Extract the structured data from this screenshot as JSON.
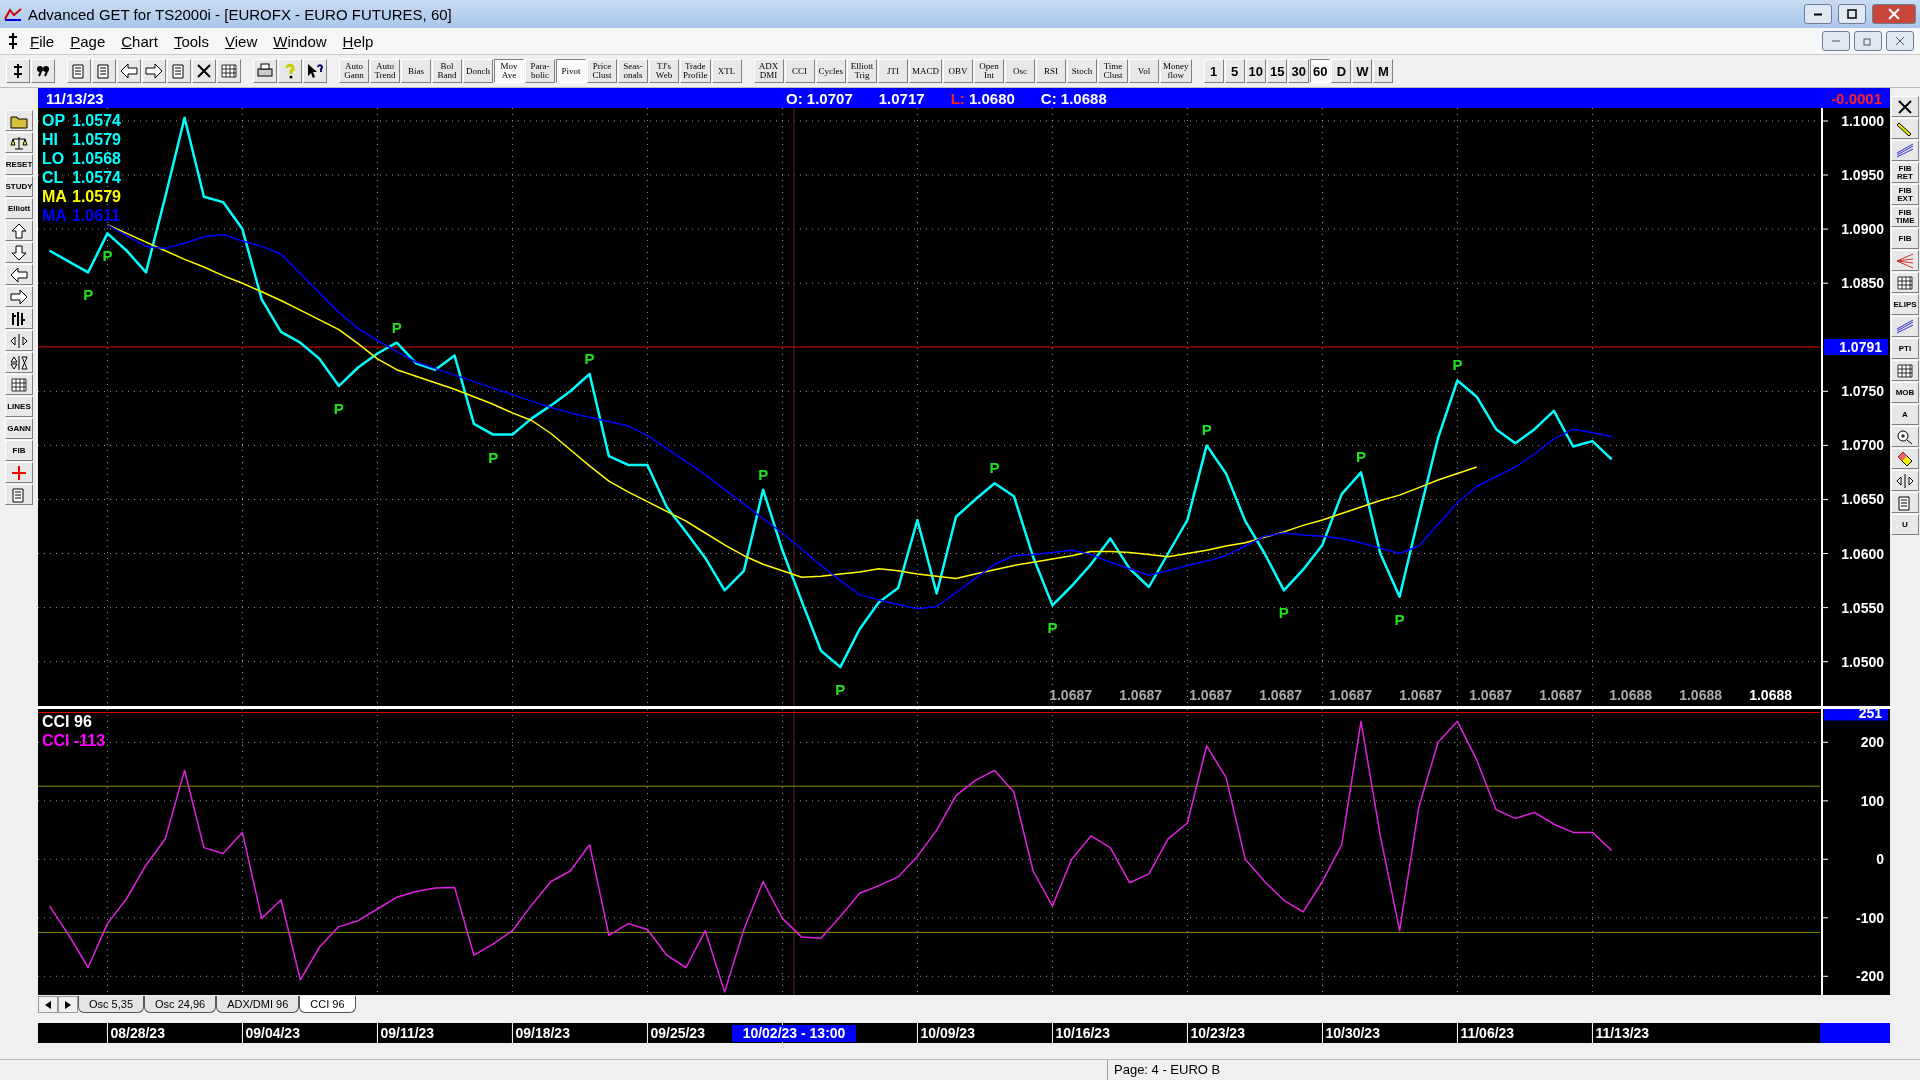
{
  "window": {
    "title": "Advanced GET for TS2000i - [EUROFX - EURO FUTURES, 60]"
  },
  "menu": [
    "File",
    "Page",
    "Chart",
    "Tools",
    "View",
    "Window",
    "Help"
  ],
  "study_buttons": [
    {
      "label": "Auto\nGann",
      "selected": false
    },
    {
      "label": "Auto\nTrend",
      "selected": false
    },
    {
      "label": "Bias",
      "selected": false
    },
    {
      "label": "Bol\nBand",
      "selected": false
    },
    {
      "label": "Donch",
      "selected": false
    },
    {
      "label": "Mov\nAve",
      "selected": true
    },
    {
      "label": "Para-\nbolic",
      "selected": false
    },
    {
      "label": "Pivot",
      "selected": true
    },
    {
      "label": "Price\nClust",
      "selected": false
    },
    {
      "label": "Seas-\nonals",
      "selected": false
    },
    {
      "label": "TJ's\nWeb",
      "selected": false
    },
    {
      "label": "Trade\nProfile",
      "selected": false
    },
    {
      "label": "XTL",
      "selected": false
    }
  ],
  "indicator_buttons": [
    {
      "label": "ADX\nDMI",
      "selected": false
    },
    {
      "label": "CCI",
      "selected": false
    },
    {
      "label": "Cycles",
      "selected": false
    },
    {
      "label": "Elliott\nTrig",
      "selected": false
    },
    {
      "label": "JTI",
      "selected": false
    },
    {
      "label": "MACD",
      "selected": false
    },
    {
      "label": "OBV",
      "selected": false
    },
    {
      "label": "Open\nInt",
      "selected": false
    },
    {
      "label": "Osc",
      "selected": false
    },
    {
      "label": "RSI",
      "selected": false
    },
    {
      "label": "Stoch",
      "selected": false
    },
    {
      "label": "Time\nClust",
      "selected": false
    },
    {
      "label": "Vol",
      "selected": false
    },
    {
      "label": "Money\nflow",
      "selected": false
    }
  ],
  "interval_buttons": [
    {
      "label": "1",
      "selected": false
    },
    {
      "label": "5",
      "selected": false
    },
    {
      "label": "10",
      "selected": false
    },
    {
      "label": "15",
      "selected": false
    },
    {
      "label": "30",
      "selected": false
    },
    {
      "label": "60",
      "selected": true
    },
    {
      "label": "D",
      "selected": false
    },
    {
      "label": "W",
      "selected": false
    },
    {
      "label": "M",
      "selected": false
    }
  ],
  "left_toolbar": [
    {
      "kind": "folder"
    },
    {
      "kind": "scales"
    },
    {
      "kind": "label",
      "label": "RESET"
    },
    {
      "kind": "label",
      "label": "STUDY"
    },
    {
      "kind": "label",
      "label": "Elliott"
    },
    {
      "kind": "up"
    },
    {
      "kind": "down"
    },
    {
      "kind": "left"
    },
    {
      "kind": "right"
    },
    {
      "kind": "bars"
    },
    {
      "kind": "widen"
    },
    {
      "kind": "squeeze"
    },
    {
      "kind": "grid"
    },
    {
      "kind": "label",
      "label": "LINES"
    },
    {
      "kind": "label",
      "label": "GANN"
    },
    {
      "kind": "label",
      "label": "FIB"
    },
    {
      "kind": "cross"
    },
    {
      "kind": "notes"
    }
  ],
  "right_toolbar": [
    {
      "kind": "close"
    },
    {
      "kind": "pencil"
    },
    {
      "kind": "lines"
    },
    {
      "kind": "label",
      "label": "FIB\nRET"
    },
    {
      "kind": "label",
      "label": "FIB\nEXT"
    },
    {
      "kind": "label",
      "label": "FIB\nTIME"
    },
    {
      "kind": "label",
      "label": "FIB"
    },
    {
      "kind": "fan"
    },
    {
      "kind": "grid"
    },
    {
      "kind": "label",
      "label": "ELIPS"
    },
    {
      "kind": "lines"
    },
    {
      "kind": "label",
      "label": "PTI"
    },
    {
      "kind": "grid"
    },
    {
      "kind": "label",
      "label": "MOB"
    },
    {
      "kind": "label",
      "label": "A"
    },
    {
      "kind": "zoom"
    },
    {
      "kind": "eraser"
    },
    {
      "kind": "expand"
    },
    {
      "kind": "pages"
    },
    {
      "kind": "label",
      "label": "U"
    }
  ],
  "info_bar": {
    "date": "11/13/23",
    "fields": [
      {
        "label": "O:",
        "value": "1.0707",
        "alert": false
      },
      {
        "value": "1.0717",
        "alert": false
      },
      {
        "label": "L:",
        "value": "1.0680",
        "alert": true
      },
      {
        "label": "C:",
        "value": "1.0688",
        "alert": false
      }
    ],
    "change": "-0.0001"
  },
  "date_axis": {
    "labels": [
      "08/28/23",
      "09/04/23",
      "09/11/23",
      "09/18/23",
      "09/25/23",
      "10/09/23",
      "10/16/23",
      "10/23/23",
      "10/30/23",
      "11/06/23",
      "11/13/23"
    ],
    "crosshair": "10/02/23 - 13:00"
  },
  "price_chart": {
    "legend": [
      {
        "label": "OP",
        "value": "1.0574",
        "color": "#00ffff"
      },
      {
        "label": "HI",
        "value": "1.0579",
        "color": "#00ffff"
      },
      {
        "label": "LO",
        "value": "1.0568",
        "color": "#00ffff"
      },
      {
        "label": "CL",
        "value": "1.0574",
        "color": "#00ffff"
      },
      {
        "label": "MA",
        "value": "1.0579",
        "color": "#ffff00"
      },
      {
        "label": "MA",
        "value": "1.0611",
        "color": "#0000ff"
      }
    ],
    "readings": [
      {
        "text": "1.0687",
        "current": false
      },
      {
        "text": "1.0687",
        "current": false
      },
      {
        "text": "1.0687",
        "current": false
      },
      {
        "text": "1.0687",
        "current": false
      },
      {
        "text": "1.0687",
        "current": false
      },
      {
        "text": "1.0687",
        "current": false
      },
      {
        "text": "1.0687",
        "current": false
      },
      {
        "text": "1.0687",
        "current": false
      },
      {
        "text": "1.0688",
        "current": false
      },
      {
        "text": "1.0688",
        "current": false
      },
      {
        "text": "1.0688",
        "current": true
      }
    ],
    "pivots": [
      "P",
      "P",
      "P",
      "P",
      "P",
      "P",
      "P",
      "P",
      "P",
      "P",
      "P",
      "P",
      "P",
      "P",
      "P"
    ],
    "chart_data": {
      "type": "line",
      "grid": true,
      "ylim": [
        1.0459,
        1.1012
      ],
      "categories": [
        null,
        null,
        null,
        null,
        null,
        null,
        null,
        null,
        null,
        null,
        null,
        null,
        null,
        null,
        null,
        null,
        null,
        null,
        null,
        null,
        null,
        null,
        null,
        null,
        null,
        null,
        null,
        null,
        null,
        null,
        null,
        null,
        null,
        null,
        null,
        null,
        null,
        null,
        null,
        null,
        null,
        null,
        null,
        null,
        null,
        null,
        null,
        null,
        null,
        null,
        null,
        null,
        null,
        null,
        null,
        null,
        null,
        null,
        null,
        null,
        null,
        null,
        null,
        null,
        null,
        null,
        null,
        null,
        null,
        null,
        null,
        null,
        null,
        null,
        null,
        null,
        null,
        null,
        null,
        null,
        null,
        null
      ],
      "yticks": [
        {
          "value": 1.05,
          "label": "1.0500"
        },
        {
          "value": 1.055,
          "label": "1.0550"
        },
        {
          "value": 1.06,
          "label": "1.0600"
        },
        {
          "value": 1.065,
          "label": "1.0650"
        },
        {
          "value": 1.07,
          "label": "1.0700"
        },
        {
          "value": 1.075,
          "label": "1.0750"
        },
        {
          "value": 1.085,
          "label": "1.0850"
        },
        {
          "value": 1.09,
          "label": "1.0900"
        },
        {
          "value": 1.095,
          "label": "1.0950"
        },
        {
          "value": 1.1,
          "label": "1.1000"
        }
      ],
      "series": [
        {
          "color": "#00ffff",
          "values": [
            1.088,
            1.087,
            1.086,
            1.0896,
            1.088,
            1.086,
            1.093,
            1.1003,
            1.093,
            1.0925,
            1.09,
            1.0835,
            1.0805,
            1.0795,
            1.078,
            1.0755,
            1.0772,
            1.0785,
            1.0795,
            1.0776,
            1.077,
            1.0783,
            1.072,
            1.071,
            1.071,
            1.0725,
            1.0737,
            1.075,
            1.0766,
            1.069,
            1.0682,
            1.0682,
            1.0643,
            1.062,
            1.0596,
            1.0566,
            1.0584,
            1.0659,
            1.0603,
            1.0556,
            1.051,
            1.0495,
            1.053,
            1.0555,
            1.0568,
            1.0631,
            1.0563,
            1.0634,
            1.065,
            1.0665,
            1.0653,
            1.0597,
            1.0552,
            1.057,
            1.059,
            1.0614,
            1.0586,
            1.0569,
            1.06,
            1.0631,
            1.07,
            1.0674,
            1.063,
            1.06,
            1.0566,
            1.0585,
            1.0608,
            1.0655,
            1.0675,
            1.06,
            1.056,
            1.0635,
            1.0707,
            1.076,
            1.0745,
            1.0715,
            1.0702,
            1.0715,
            1.0732,
            1.0699,
            1.0704,
            1.0687
          ]
        },
        {
          "color": "#ffff00",
          "values": [
            null,
            null,
            null,
            1.0904,
            1.0896,
            1.0888,
            1.088,
            1.0872,
            1.0865,
            1.0857,
            1.085,
            1.0842,
            1.0834,
            1.0825,
            1.0816,
            1.0807,
            1.0794,
            1.078,
            1.077,
            1.0764,
            1.0758,
            1.0752,
            1.0745,
            1.0738,
            1.073,
            1.0723,
            1.0711,
            1.0696,
            1.0681,
            1.0667,
            1.0657,
            1.0648,
            1.0639,
            1.063,
            1.0619,
            1.0608,
            1.0598,
            1.059,
            1.0584,
            1.0578,
            1.0579,
            1.0581,
            1.0583,
            1.0586,
            1.0584,
            1.0581,
            1.0579,
            1.0577,
            1.0581,
            1.0585,
            1.0589,
            1.0592,
            1.0595,
            1.0598,
            1.0602,
            1.0602,
            1.0601,
            1.0599,
            1.0597,
            1.06,
            1.0603,
            1.0607,
            1.061,
            1.0615,
            1.062,
            1.0626,
            1.0631,
            1.0637,
            1.0643,
            1.0649,
            1.0654,
            1.0661,
            1.0668,
            1.0674,
            1.068,
            null,
            null,
            null,
            null,
            null,
            null,
            null
          ]
        },
        {
          "color": "#0000ff",
          "values": [
            null,
            null,
            null,
            1.0904,
            1.0894,
            1.0884,
            1.0882,
            1.0887,
            1.0893,
            1.0895,
            1.0889,
            1.0884,
            1.0877,
            1.0859,
            1.0841,
            1.0823,
            1.0808,
            1.0797,
            1.0787,
            1.0777,
            1.0771,
            1.0765,
            1.0759,
            1.0753,
            1.0747,
            1.0741,
            1.0735,
            1.073,
            1.0726,
            1.0722,
            1.0718,
            1.0709,
            1.0697,
            1.0685,
            1.0673,
            1.0659,
            1.0646,
            1.0632,
            1.0619,
            1.0604,
            1.0589,
            1.0575,
            1.0562,
            1.0557,
            1.0553,
            1.0549,
            1.0551,
            1.0564,
            1.0577,
            1.059,
            1.0598,
            1.0599,
            1.0601,
            1.0603,
            1.0599,
            1.0592,
            1.0586,
            1.058,
            1.0584,
            1.0589,
            1.0593,
            1.0598,
            1.0607,
            1.0616,
            1.0619,
            1.0617,
            1.0616,
            1.0614,
            1.061,
            1.0605,
            1.06,
            1.0607,
            1.0627,
            1.0647,
            1.0662,
            1.0671,
            1.068,
            1.0692,
            1.0706,
            1.0715,
            1.0712,
            1.0708
          ]
        }
      ],
      "ref_lines": [
        {
          "axis": "y",
          "value": 1.0791,
          "color": "#e00000",
          "label": "1.0791"
        }
      ]
    }
  },
  "cci_chart": {
    "legend": [
      {
        "label": "CCI 96",
        "color": "#ffffff"
      },
      {
        "label": "CCI  -113",
        "color": "#ff00ff"
      }
    ],
    "chart_data": {
      "type": "line",
      "grid": true,
      "ylim": [
        -232,
        257
      ],
      "yticks": [
        -200,
        -100,
        0,
        100,
        200
      ],
      "categories": [
        null,
        null,
        null,
        null,
        null,
        null,
        null,
        null,
        null,
        null,
        null,
        null,
        null,
        null,
        null,
        null,
        null,
        null,
        null,
        null,
        null,
        null,
        null,
        null,
        null,
        null,
        null,
        null,
        null,
        null,
        null,
        null,
        null,
        null,
        null,
        null,
        null,
        null,
        null,
        null,
        null,
        null,
        null,
        null,
        null,
        null,
        null,
        null,
        null,
        null,
        null,
        null,
        null,
        null,
        null,
        null,
        null,
        null,
        null,
        null,
        null,
        null,
        null,
        null,
        null,
        null,
        null,
        null,
        null,
        null,
        null,
        null,
        null,
        null,
        null,
        null,
        null,
        null,
        null,
        null,
        null,
        null
      ],
      "series": [
        {
          "color": "#e020e0",
          "values": [
            -80,
            -130,
            -185,
            -110,
            -67,
            -10,
            35,
            152,
            20,
            10,
            46,
            -101,
            -69,
            -206,
            -150,
            -115,
            -105,
            -85,
            -65,
            -55,
            -49,
            -48,
            -164,
            -145,
            -122,
            -78,
            -38,
            -20,
            25,
            -130,
            -110,
            -120,
            -164,
            -185,
            -122,
            -227,
            -120,
            -38,
            -101,
            -133,
            -135,
            -98,
            -58,
            -45,
            -30,
            5,
            50,
            109,
            135,
            152,
            115,
            -20,
            -80,
            0,
            40,
            20,
            -40,
            -25,
            35,
            62,
            194,
            140,
            0,
            -38,
            -70,
            -90,
            -38,
            25,
            236,
            40,
            -122,
            90,
            200,
            236,
            170,
            85,
            70,
            80,
            60,
            46,
            46,
            15
          ]
        }
      ],
      "ref_lines": [
        {
          "axis": "y",
          "value": 125,
          "color": "#8a8a00"
        },
        {
          "axis": "y",
          "value": -125,
          "color": "#8a8a00"
        },
        {
          "axis": "y",
          "value": 251,
          "color": "#e00000",
          "label": "251"
        }
      ]
    }
  },
  "chart_tabs": [
    {
      "label": "Osc 5,35",
      "selected": false
    },
    {
      "label": "Osc 24,96",
      "selected": false
    },
    {
      "label": "ADX/DMI 96",
      "selected": false
    },
    {
      "label": "CCI 96",
      "selected": true
    }
  ],
  "status_bar": {
    "page": "Page: 4 - EURO B"
  }
}
